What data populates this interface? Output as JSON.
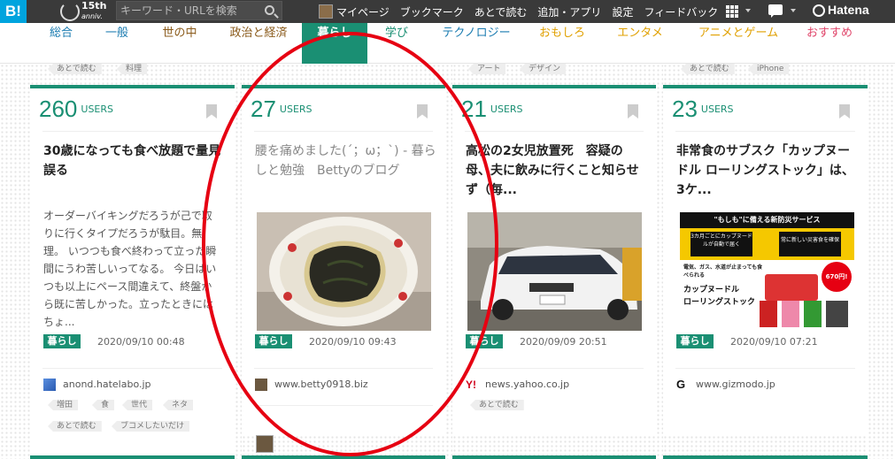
{
  "topbar": {
    "logo": "B!",
    "anniv_top": "15th",
    "anniv_bottom": "anniv.",
    "search_placeholder": "キーワード・URLを検索",
    "nav": [
      "マイページ",
      "ブックマーク",
      "あとで読む",
      "追加・アプリ",
      "設定",
      "フィードバック"
    ],
    "brand": "Hatena"
  },
  "categories": [
    {
      "label": "総合",
      "color": "#1a7bb0"
    },
    {
      "label": "一般",
      "color": "#1a7bb0"
    },
    {
      "label": "世の中",
      "color": "#8a5a1a"
    },
    {
      "label": "政治と経済",
      "color": "#8a5a1a"
    },
    {
      "label": "暮らし",
      "color": "#ffffff",
      "active": true
    },
    {
      "label": "学び",
      "color": "#1a8f73"
    },
    {
      "label": "テクノロジー",
      "color": "#1a7bb0"
    },
    {
      "label": "おもしろ",
      "color": "#e0a000"
    },
    {
      "label": "エンタメ",
      "color": "#e0a000"
    },
    {
      "label": "アニメとゲーム",
      "color": "#e0a000"
    },
    {
      "label": "おすすめ",
      "color": "#e0456a"
    }
  ],
  "users_label": "USERS",
  "columns": [
    {
      "top_tags": [
        "あとで読む",
        "料理"
      ],
      "users": "260",
      "title": "30歳になっても食べ放題で量見誤る",
      "excerpt": "オーダーバイキングだろうが己で取りに行くタイプだろうが駄目。無理。 いつつも食べ終わって立った瞬間にうわ苦しいってなる。 今日はいつも以上にペース間違えて、終盤から既に苦しかった。立ったときにはちょ...",
      "category": "暮らし",
      "date": "2020/09/10 00:48",
      "site": "anond.hatelabo.jp",
      "tags": [
        "増田",
        "食",
        "世代",
        "ネタ",
        "あとで読む",
        "ブコメしたいだけ"
      ]
    },
    {
      "top_tags": [],
      "users": "27",
      "title": "腰を痛めました(´；ω；`) - 暮らしと勉強　Bettyのブログ",
      "category": "暮らし",
      "date": "2020/09/10 09:43",
      "site": "www.betty0918.biz",
      "tags": []
    },
    {
      "top_tags": [
        "アート",
        "デザイン"
      ],
      "users": "21",
      "title": "高松の2女児放置死　容疑の母、夫に飲みに行くこと知らせず（毎...",
      "category": "暮らし",
      "date": "2020/09/09 20:51",
      "site": "news.yahoo.co.jp",
      "tags": [
        "あとで読む"
      ]
    },
    {
      "top_tags": [
        "あとで読む",
        "iPhone"
      ],
      "users": "23",
      "title": "非常食のサブスク「カップヌードル ローリングストック」は、3ケ...",
      "category": "暮らし",
      "date": "2020/09/10 07:21",
      "site": "www.gizmodo.jp",
      "tags": [],
      "ad": {
        "headline": "\"もしも\"に備える新防災サービス",
        "box1": "3カ月ごとにカップヌードルが自動で届く",
        "box2": "常に新しい災害食を確保",
        "line1": "電気、ガス、水道が止まっても食べられる",
        "line2": "カップヌードル",
        "line3": "ローリングストック",
        "price": "670円!"
      }
    }
  ]
}
